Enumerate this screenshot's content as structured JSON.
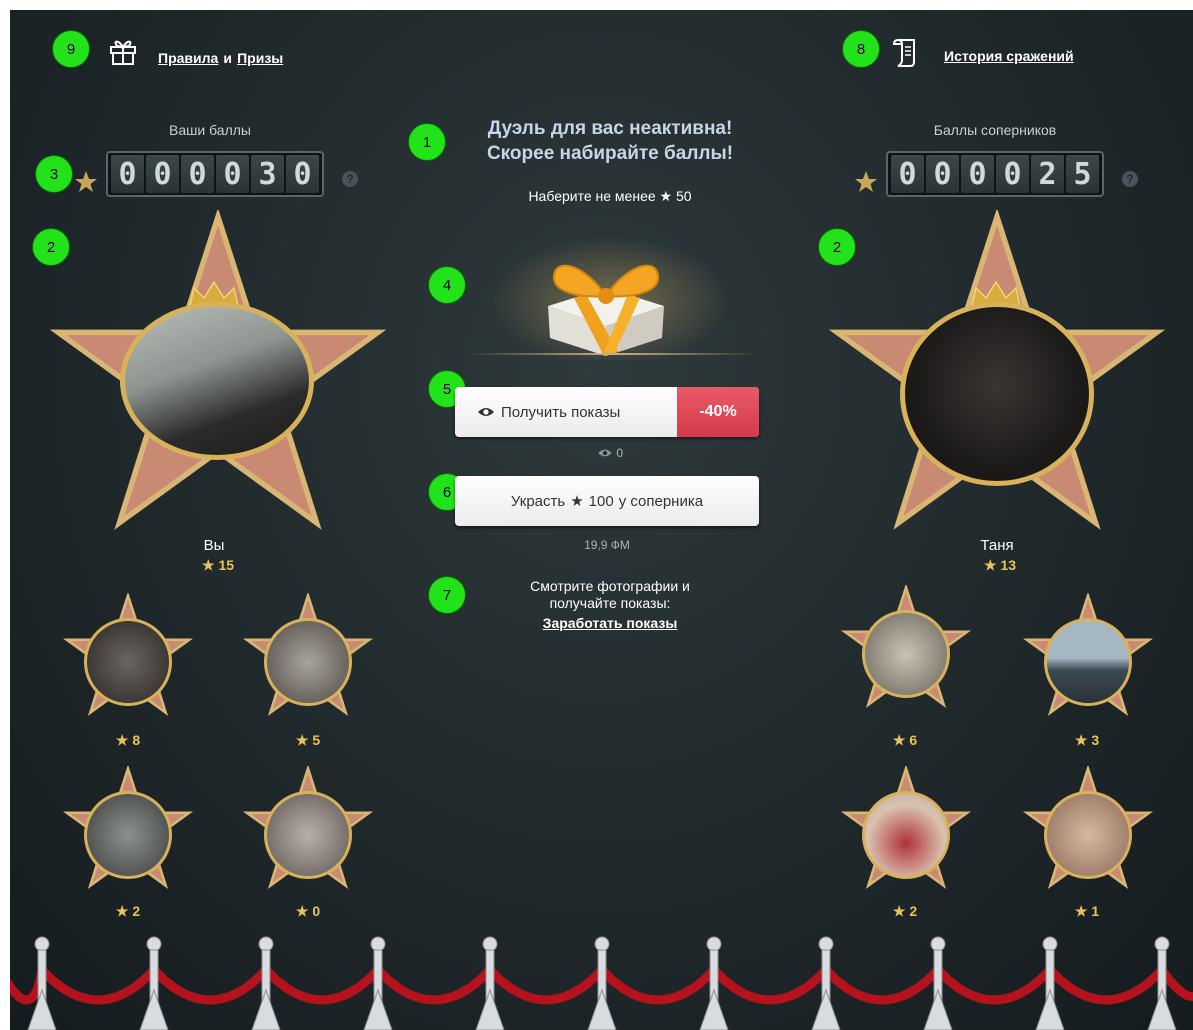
{
  "header": {
    "rules_link": "Правила",
    "and_text": "и",
    "prizes_link": "Призы",
    "history_link": "История сражений",
    "badge_rules": "9",
    "badge_history": "8"
  },
  "left": {
    "points_label": "Ваши баллы",
    "digits": [
      "0",
      "0",
      "0",
      "0",
      "3",
      "0"
    ],
    "help": "?",
    "badge_counter": "3",
    "badge_star": "2",
    "name": "Вы",
    "score": "15",
    "small": [
      {
        "score": "8"
      },
      {
        "score": "5"
      },
      {
        "score": "2"
      },
      {
        "score": "0"
      }
    ]
  },
  "right": {
    "points_label": "Баллы соперников",
    "digits": [
      "0",
      "0",
      "0",
      "0",
      "2",
      "5"
    ],
    "help": "?",
    "badge_star": "2",
    "name": "Таня",
    "score": "13",
    "small": [
      {
        "score": "6"
      },
      {
        "score": "3"
      },
      {
        "score": "2"
      },
      {
        "score": "1"
      }
    ]
  },
  "center": {
    "badge_title": "1",
    "title_line1": "Дуэль для вас неактивна!",
    "title_line2": "Скорее набирайте баллы!",
    "min_text": "Наберите не менее",
    "min_value": "50",
    "badge_gift": "4",
    "badge_get": "5",
    "get_button": "Получить показы",
    "discount": "-40%",
    "views_count": "0",
    "badge_steal": "6",
    "steal_prefix": "Украсть",
    "steal_value": "100",
    "steal_suffix": "у соперника",
    "steal_price": "19,9 ФМ",
    "badge_earn": "7",
    "earn_line1": "Смотрите фотографии и",
    "earn_line2": "получайте показы:",
    "earn_link": "Заработать показы"
  },
  "colors": {
    "badge": "#22e31a",
    "gold": "#e8c455",
    "discount": "#d43a4b",
    "star_fill": "#c98a74"
  },
  "icons": [
    "gift-icon",
    "scroll-icon",
    "star-icon",
    "eye-icon",
    "crown-icon",
    "help-icon"
  ]
}
